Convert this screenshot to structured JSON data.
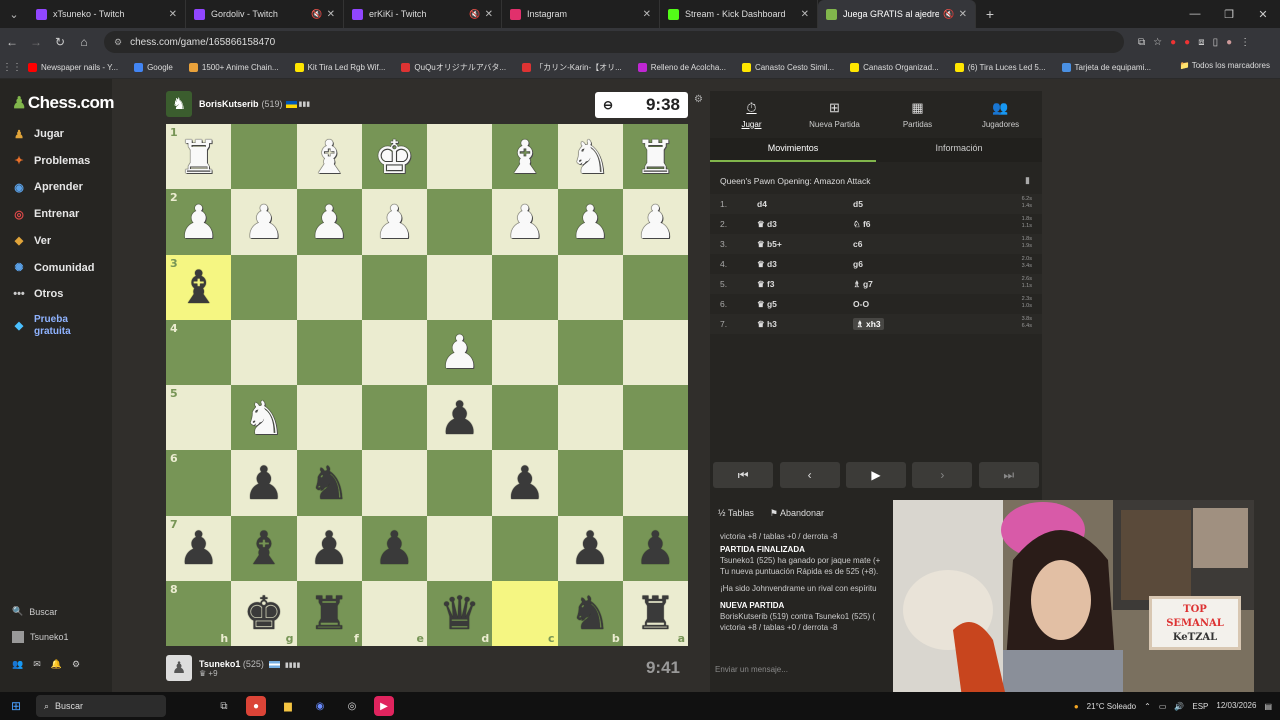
{
  "browser": {
    "tabs": [
      {
        "title": "xTsuneko - Twitch",
        "favicon_color": "#9146ff",
        "muted": false,
        "active": false
      },
      {
        "title": "Gordoliv - Twitch",
        "favicon_color": "#9146ff",
        "muted": true,
        "active": false
      },
      {
        "title": "erKiKi - Twitch",
        "favicon_color": "#9146ff",
        "muted": true,
        "active": false
      },
      {
        "title": "Instagram",
        "favicon_color": "#e1306c",
        "muted": false,
        "active": false
      },
      {
        "title": "Stream - Kick Dashboard",
        "favicon_color": "#53fc18",
        "muted": false,
        "active": false
      },
      {
        "title": "Juega GRATIS al ajedrez on",
        "favicon_color": "#81b64c",
        "muted": true,
        "active": true
      }
    ],
    "url": "chess.com/game/165866158470",
    "bookmarks": [
      {
        "label": "Newspaper nails - Y...",
        "color": "#ff0000"
      },
      {
        "label": "Google",
        "color": "#4285f4"
      },
      {
        "label": "1500+ Anime Chain...",
        "color": "#e9a23b"
      },
      {
        "label": "Kit Tira Led Rgb Wif...",
        "color": "#ffe600"
      },
      {
        "label": "QuQuオリジナルアバタ...",
        "color": "#d33"
      },
      {
        "label": "「カリン-Karin-【オリ...",
        "color": "#d33"
      },
      {
        "label": "Relleno de Acolcha...",
        "color": "#c026d3"
      },
      {
        "label": "Canasto Cesto Simil...",
        "color": "#ffe600"
      },
      {
        "label": "Canasto Organizad...",
        "color": "#ffe600"
      },
      {
        "label": "(6) Tira Luces Led 5...",
        "color": "#ffe600"
      },
      {
        "label": "Tarjeta de equipami...",
        "color": "#4a90e2"
      }
    ],
    "bookmarks_all": "Todos los marcadores"
  },
  "sidebar": {
    "logo": "Chess.com",
    "items": [
      {
        "label": "Jugar",
        "icon": "play-icon",
        "color": "#e0a43a"
      },
      {
        "label": "Problemas",
        "icon": "puzzle-icon",
        "color": "#e8702a"
      },
      {
        "label": "Aprender",
        "icon": "learn-icon",
        "color": "#5aa0e6"
      },
      {
        "label": "Entrenar",
        "icon": "train-icon",
        "color": "#e04a4a"
      },
      {
        "label": "Ver",
        "icon": "watch-icon",
        "color": "#e0a43a"
      },
      {
        "label": "Comunidad",
        "icon": "community-icon",
        "color": "#5aa0e6"
      },
      {
        "label": "Otros",
        "icon": "more-icon",
        "color": "#ccc"
      }
    ],
    "promo_line1": "Prueba",
    "promo_line2": "gratuita",
    "search_label": "Buscar",
    "user_label": "Tsuneko1"
  },
  "top_player": {
    "name": "BorisKutserib",
    "rating": "(519)",
    "clock": "9:38"
  },
  "bottom_player": {
    "name": "Tsuneko1",
    "rating": "(525)",
    "score": "+9",
    "clock": "9:41"
  },
  "board": {
    "rank_labels": [
      "1",
      "2",
      "3",
      "4",
      "5",
      "6",
      "7",
      "8"
    ],
    "file_labels": [
      "h",
      "g",
      "f",
      "e",
      "d",
      "c",
      "b",
      "a"
    ],
    "highlights": [
      "3-0",
      "8-5"
    ],
    "pieces": [
      {
        "rank": 0,
        "col": 0,
        "c": "w",
        "p": "♜"
      },
      {
        "rank": 0,
        "col": 2,
        "c": "w",
        "p": "♝"
      },
      {
        "rank": 0,
        "col": 3,
        "c": "w",
        "p": "♚"
      },
      {
        "rank": 0,
        "col": 5,
        "c": "w",
        "p": "♝"
      },
      {
        "rank": 0,
        "col": 6,
        "c": "w",
        "p": "♞"
      },
      {
        "rank": 0,
        "col": 7,
        "c": "w",
        "p": "♜"
      },
      {
        "rank": 1,
        "col": 0,
        "c": "w",
        "p": "♟"
      },
      {
        "rank": 1,
        "col": 1,
        "c": "w",
        "p": "♟"
      },
      {
        "rank": 1,
        "col": 2,
        "c": "w",
        "p": "♟"
      },
      {
        "rank": 1,
        "col": 3,
        "c": "w",
        "p": "♟"
      },
      {
        "rank": 1,
        "col": 5,
        "c": "w",
        "p": "♟"
      },
      {
        "rank": 1,
        "col": 6,
        "c": "w",
        "p": "♟"
      },
      {
        "rank": 1,
        "col": 7,
        "c": "w",
        "p": "♟"
      },
      {
        "rank": 2,
        "col": 0,
        "c": "b",
        "p": "♝"
      },
      {
        "rank": 3,
        "col": 4,
        "c": "w",
        "p": "♟"
      },
      {
        "rank": 4,
        "col": 1,
        "c": "w",
        "p": "♞"
      },
      {
        "rank": 4,
        "col": 4,
        "c": "b",
        "p": "♟"
      },
      {
        "rank": 5,
        "col": 1,
        "c": "b",
        "p": "♟"
      },
      {
        "rank": 5,
        "col": 2,
        "c": "b",
        "p": "♞"
      },
      {
        "rank": 5,
        "col": 5,
        "c": "b",
        "p": "♟"
      },
      {
        "rank": 6,
        "col": 0,
        "c": "b",
        "p": "♟"
      },
      {
        "rank": 6,
        "col": 1,
        "c": "b",
        "p": "♝"
      },
      {
        "rank": 6,
        "col": 2,
        "c": "b",
        "p": "♟"
      },
      {
        "rank": 6,
        "col": 3,
        "c": "b",
        "p": "♟"
      },
      {
        "rank": 6,
        "col": 6,
        "c": "b",
        "p": "♟"
      },
      {
        "rank": 6,
        "col": 7,
        "c": "b",
        "p": "♟"
      },
      {
        "rank": 7,
        "col": 1,
        "c": "b",
        "p": "♚"
      },
      {
        "rank": 7,
        "col": 2,
        "c": "b",
        "p": "♜"
      },
      {
        "rank": 7,
        "col": 4,
        "c": "b",
        "p": "♛"
      },
      {
        "rank": 7,
        "col": 6,
        "c": "b",
        "p": "♞"
      },
      {
        "rank": 7,
        "col": 7,
        "c": "b",
        "p": "♜"
      }
    ]
  },
  "panel": {
    "tabs": [
      {
        "label": "Jugar",
        "icon": "⏱"
      },
      {
        "label": "Nueva Partida",
        "icon": "⊞"
      },
      {
        "label": "Partidas",
        "icon": "▦"
      },
      {
        "label": "Jugadores",
        "icon": "👥"
      }
    ],
    "subtabs": [
      "Movimientos",
      "Información"
    ],
    "opening": "Queen's Pawn Opening: Amazon Attack",
    "moves": [
      {
        "n": "1.",
        "w": "d4",
        "b": "d5",
        "wt": "6.2s",
        "bt": "1.4s"
      },
      {
        "n": "2.",
        "w": "♛ d3",
        "b": "♘ f6",
        "wt": "1.8s",
        "bt": "1.1s"
      },
      {
        "n": "3.",
        "w": "♛ b5+",
        "b": "c6",
        "wt": "1.8s",
        "bt": "1.9s"
      },
      {
        "n": "4.",
        "w": "♛ d3",
        "b": "g6",
        "wt": "2.0s",
        "bt": "3.4s"
      },
      {
        "n": "5.",
        "w": "♛ f3",
        "b": "♗ g7",
        "wt": "2.6s",
        "bt": "1.1s"
      },
      {
        "n": "6.",
        "w": "♛ g5",
        "b": "O-O",
        "wt": "2.3s",
        "bt": "1.0s"
      },
      {
        "n": "7.",
        "w": "♛ h3",
        "b": "♗ xh3",
        "wt": "3.8s",
        "bt": "6.4s"
      }
    ],
    "nav": [
      "⏮",
      "‹",
      "▶",
      "›",
      "⏭"
    ],
    "draw_label": "Tablas",
    "resign_label": "Abandonar",
    "chat": {
      "line1": "victoria +8 / tablas +0 / derrota -8",
      "h1": "PARTIDA FINALIZADA",
      "p1a": "Tsuneko1 (525) ha ganado por jaque mate (+",
      "p1b": "Tu nueva puntuación Rápida es de 525 (+8).",
      "p2": "¡Ha sido Johnvendrame un rival con espíritu",
      "h2": "NUEVA PARTIDA",
      "p3": "BorisKutserib (519) contra Tsuneko1 (525) (",
      "p4": "victoria +8 / tablas +0 / derrota -8"
    },
    "chat_placeholder": "Enviar un mensaje..."
  },
  "webcam_sign": {
    "line1": "TOP",
    "line2": "SEMANAL",
    "line3": "KeTZAL"
  },
  "taskbar": {
    "search": "Buscar",
    "weather": "21°C Soleado",
    "lang": "ESP",
    "date": "12/03/2026"
  }
}
